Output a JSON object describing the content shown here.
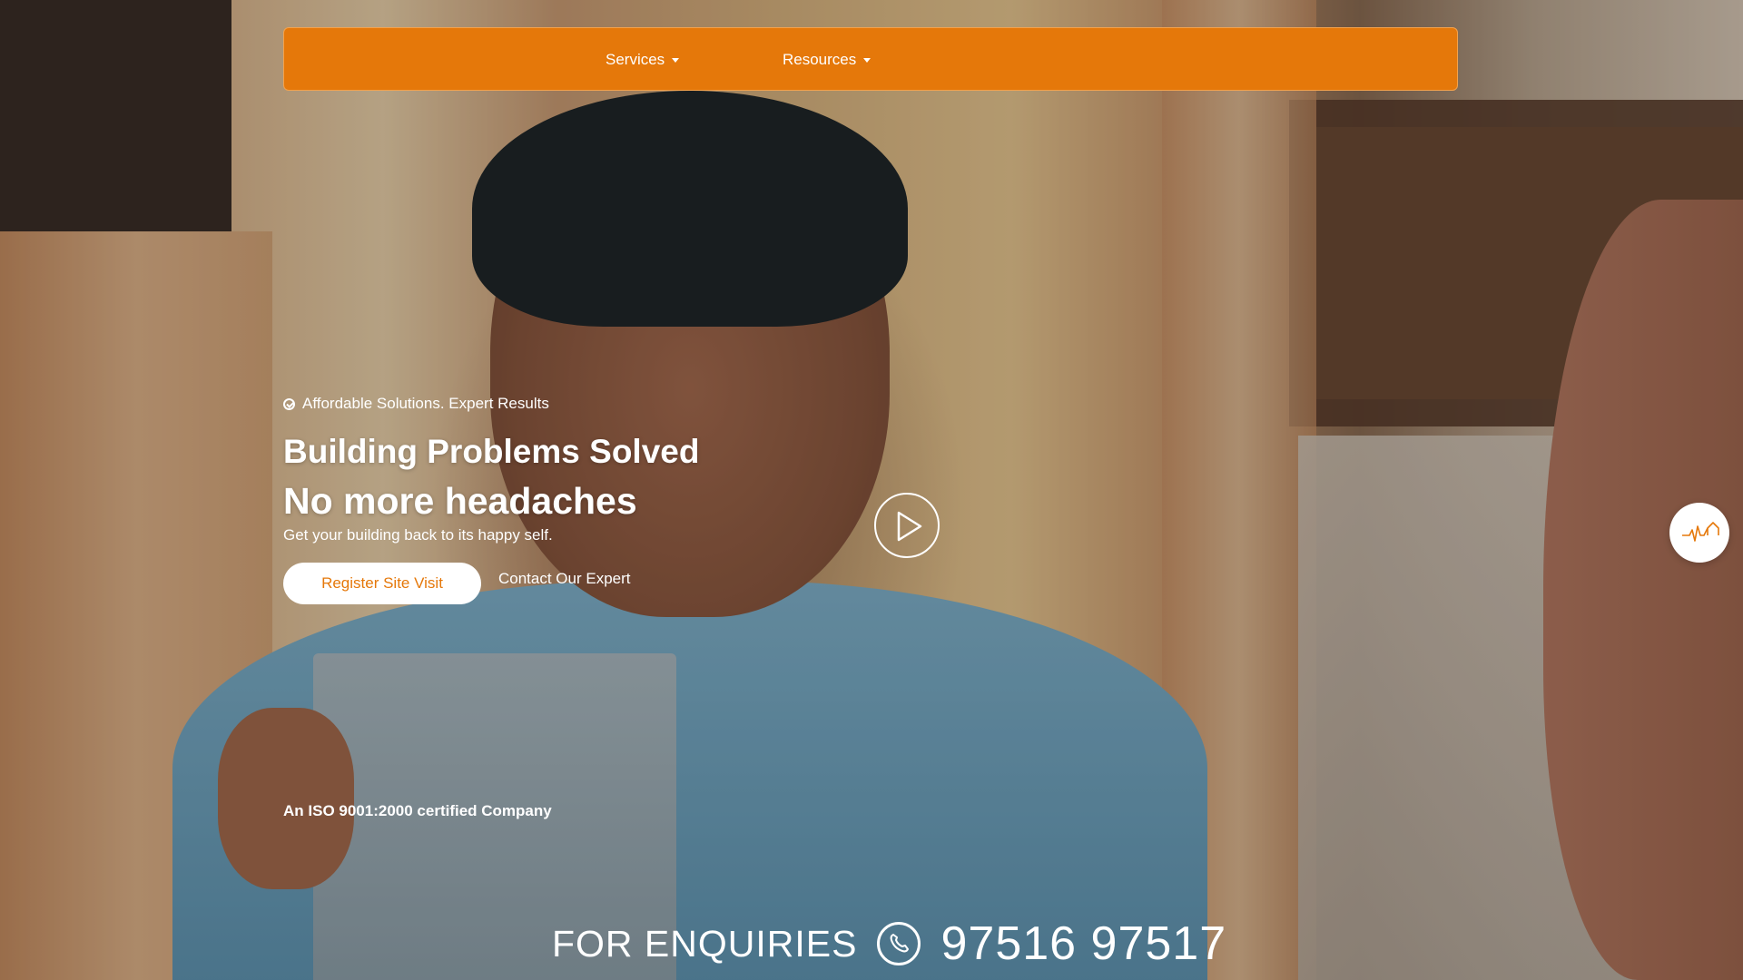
{
  "nav": {
    "services_label": "Services",
    "resources_label": "Resources"
  },
  "hero": {
    "tagline": "Affordable Solutions. Expert Results",
    "headline_line1": "Building Problems Solved",
    "headline_line2": "No more headaches",
    "subtext": "Get your building back to its happy self.",
    "register_button": "Register Site Visit",
    "contact_link": "Contact Our Expert",
    "iso_text": "An ISO 9001:2000 certified Company"
  },
  "enquiries": {
    "label": "FOR ENQUIRIES",
    "phone": "97516 97517"
  },
  "icons": {
    "tagline": "check-circle-icon",
    "play": "play-icon",
    "badge": "house-heartbeat-icon",
    "phone": "phone-icon",
    "caret": "chevron-down-icon"
  },
  "colors": {
    "accent": "#e5780a",
    "text_light": "#ffffff"
  }
}
